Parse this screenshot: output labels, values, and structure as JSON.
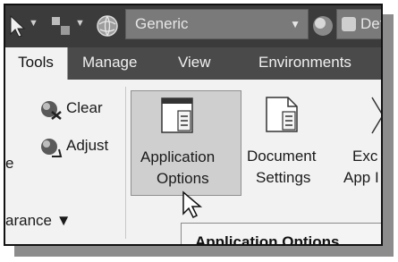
{
  "quick_access": {
    "workspace_label": "Generic",
    "appearance_label": "Defa"
  },
  "tabs": [
    "Tools",
    "Manage",
    "View",
    "Environments"
  ],
  "ribbon": {
    "clear_label": "Clear",
    "adjust_label": "Adjust",
    "partial_left_label": "e",
    "appearance_group_label": "arance ▼",
    "application_options": [
      "Application",
      "Options"
    ],
    "document_settings": [
      "Document",
      "Settings"
    ],
    "partial_right": [
      "Exc",
      "App I"
    ]
  },
  "tooltip": {
    "text": "Application Options"
  },
  "colors": {
    "titlebar": "#3b3b3b",
    "tabbar": "#4a4a4a",
    "ribbon": "#f2f2f2",
    "highlight": "#cfcfcf"
  }
}
